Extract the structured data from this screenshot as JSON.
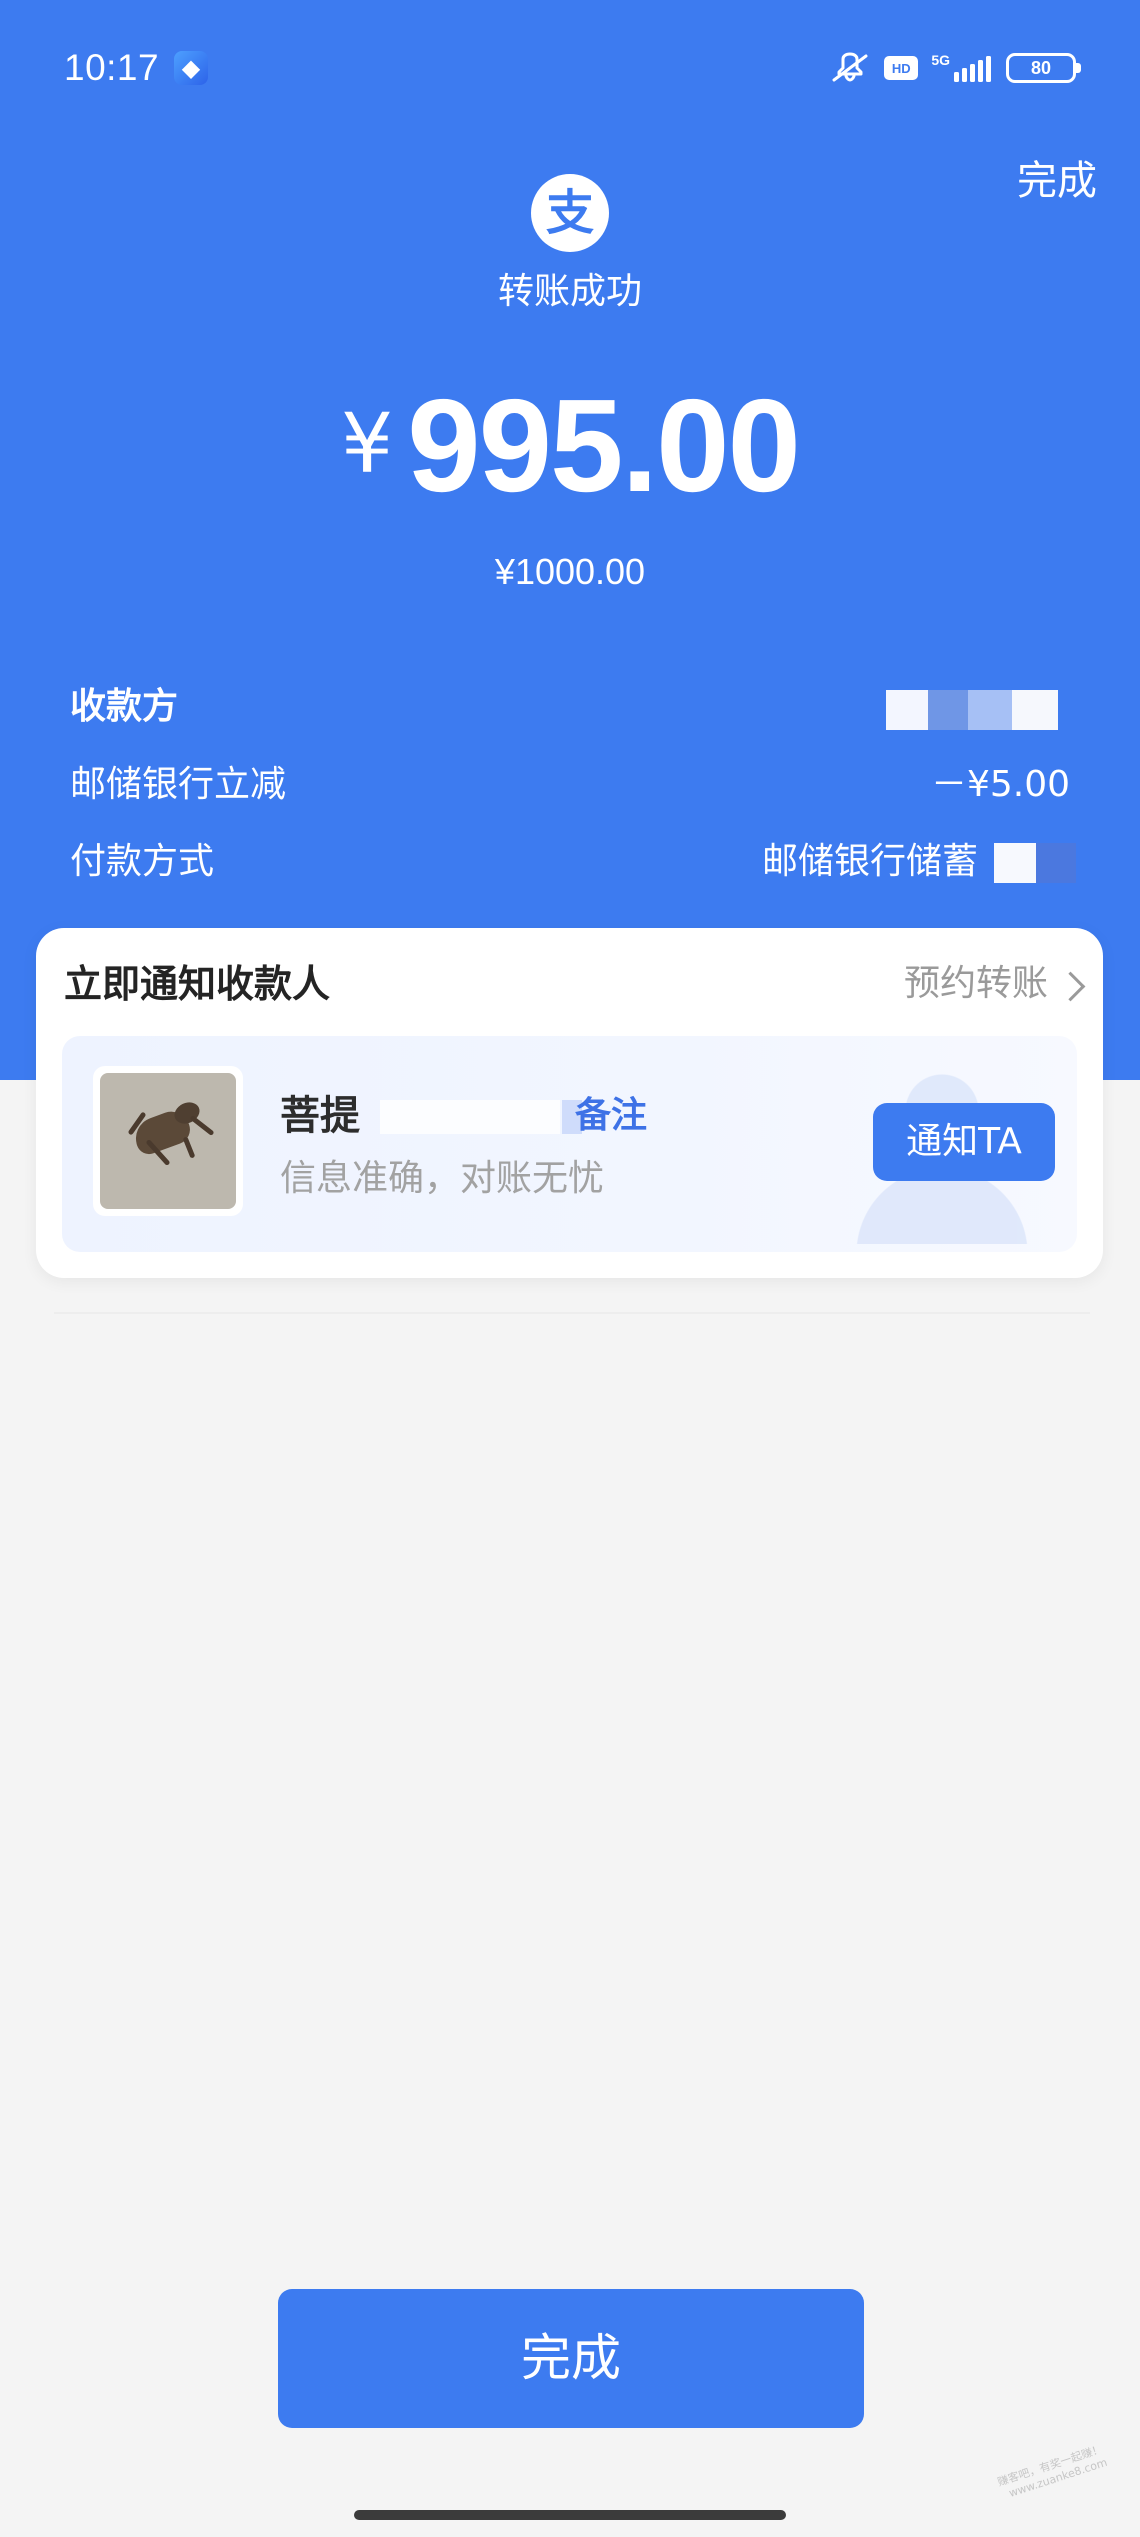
{
  "status_bar": {
    "time": "10:17",
    "hd": "HD",
    "network": "5G",
    "battery": "80"
  },
  "header": {
    "done_top": "完成",
    "logo_char": "支",
    "success_text": "转账成功",
    "currency": "¥",
    "amount": "995.00",
    "original_amount": "¥1000.00"
  },
  "details": {
    "payee_label": "收款方",
    "discount_label": "邮储银行立减",
    "discount_value": "－¥5.00",
    "payment_method_label": "付款方式",
    "payment_method_value": "邮储银行储蓄"
  },
  "notify_card": {
    "title": "立即通知收款人",
    "schedule_link": "预约转账",
    "recipient_name_prefix": "菩提",
    "remark": "备注",
    "subtext": "信息准确，对账无忧",
    "notify_button": "通知TA"
  },
  "bottom": {
    "done_button": "完成"
  },
  "watermark": {
    "line1": "赚客吧，有奖一起赚！",
    "line2": "www.zuanke8.com"
  },
  "colors": {
    "primary_blue": "#3d7bf0",
    "background_gray": "#f4f4f4",
    "white": "#ffffff",
    "secondary_text": "#9a9a9a"
  },
  "icons": {
    "app_mini": "app-icon",
    "mute": "mute-icon",
    "signal": "signal-icon",
    "battery": "battery-icon",
    "logo": "alipay-logo-icon",
    "chevron": "chevron-right-icon"
  }
}
